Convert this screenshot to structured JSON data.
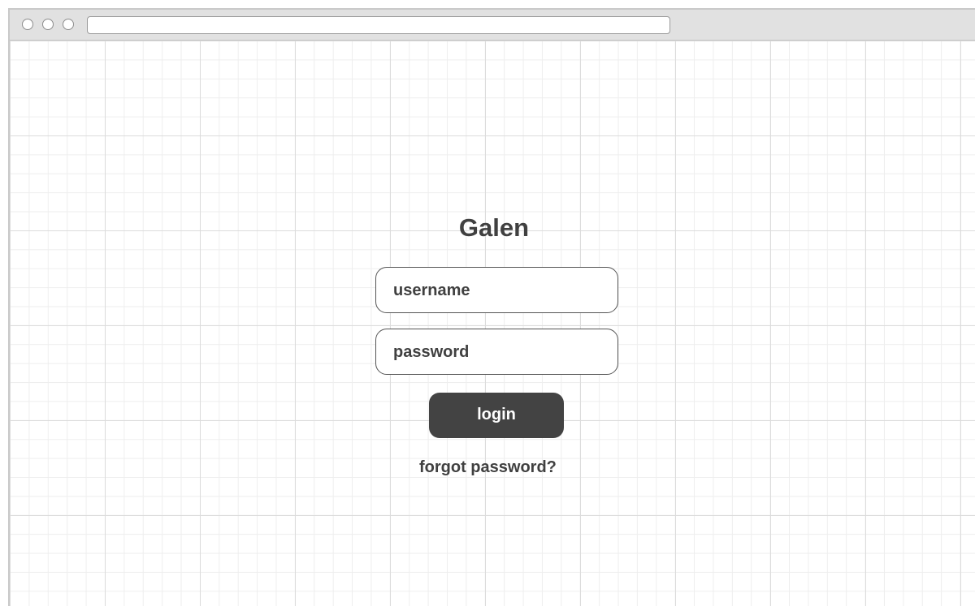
{
  "browser": {
    "address_value": ""
  },
  "login": {
    "title": "Galen",
    "username_placeholder": "username",
    "password_placeholder": "password",
    "login_label": "login",
    "forgot_label": "forgot password?"
  }
}
